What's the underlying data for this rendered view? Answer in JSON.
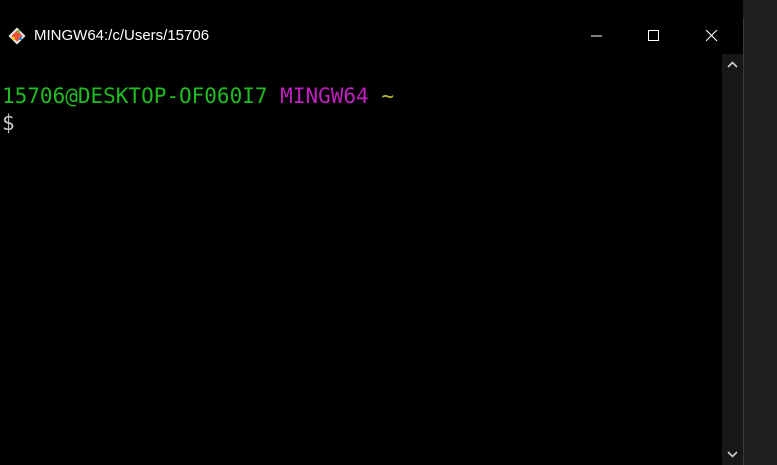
{
  "window": {
    "title": "MINGW64:/c/Users/15706",
    "icon": "git-bash-icon",
    "controls": {
      "minimize": "minimize-icon",
      "maximize": "maximize-icon",
      "close": "close-icon"
    }
  },
  "terminal": {
    "prompt": {
      "user_host": "15706@DESKTOP-OF060I7",
      "system": "MINGW64",
      "path": "~",
      "symbol": "$"
    },
    "colors": {
      "user_host": "#1fbc22",
      "system": "#bf20bf",
      "path": "#bcbc2a",
      "symbol": "#c8c8c8",
      "background": "#000000"
    }
  },
  "scrollbar": {
    "up": "chevron-up-icon",
    "down": "chevron-down-icon"
  }
}
